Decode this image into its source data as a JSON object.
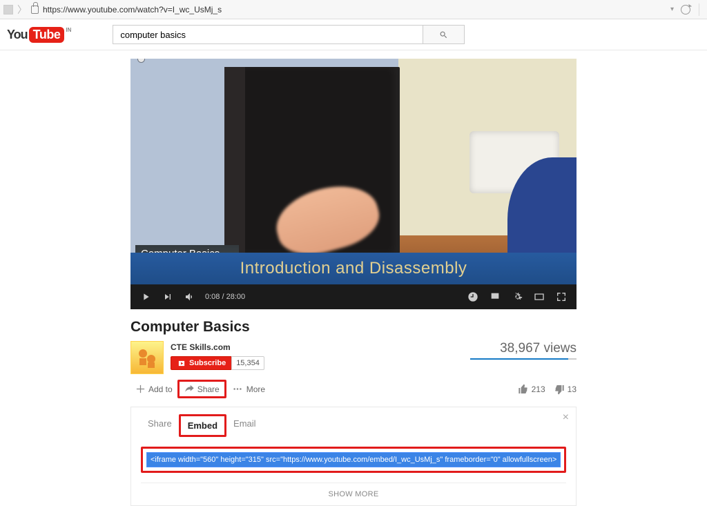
{
  "browser": {
    "url": "https://www.youtube.com/watch?v=I_wc_UsMj_s"
  },
  "logo": {
    "you": "You",
    "tube": "Tube",
    "cc": "IN"
  },
  "search": {
    "query": "computer basics"
  },
  "video": {
    "caption_box": "Computer Basics",
    "banner_title": "Introduction and Disassembly",
    "current_time": "0:08",
    "duration": "28:00",
    "title": "Computer Basics"
  },
  "channel": {
    "name": "CTE Skills.com",
    "subscribe_label": "Subscribe",
    "subscriber_count": "15,354"
  },
  "stats": {
    "views": "38,967 views",
    "likes": "213",
    "dislikes": "13"
  },
  "actions": {
    "add_to": "Add to",
    "share": "Share",
    "more": "More"
  },
  "share_panel": {
    "tabs": {
      "share": "Share",
      "embed": "Embed",
      "email": "Email"
    },
    "embed_code": "<iframe width=\"560\" height=\"315\" src=\"https://www.youtube.com/embed/I_wc_UsMj_s\" frameborder=\"0\" allowfullscreen></iframe>",
    "show_more": "Show More"
  }
}
